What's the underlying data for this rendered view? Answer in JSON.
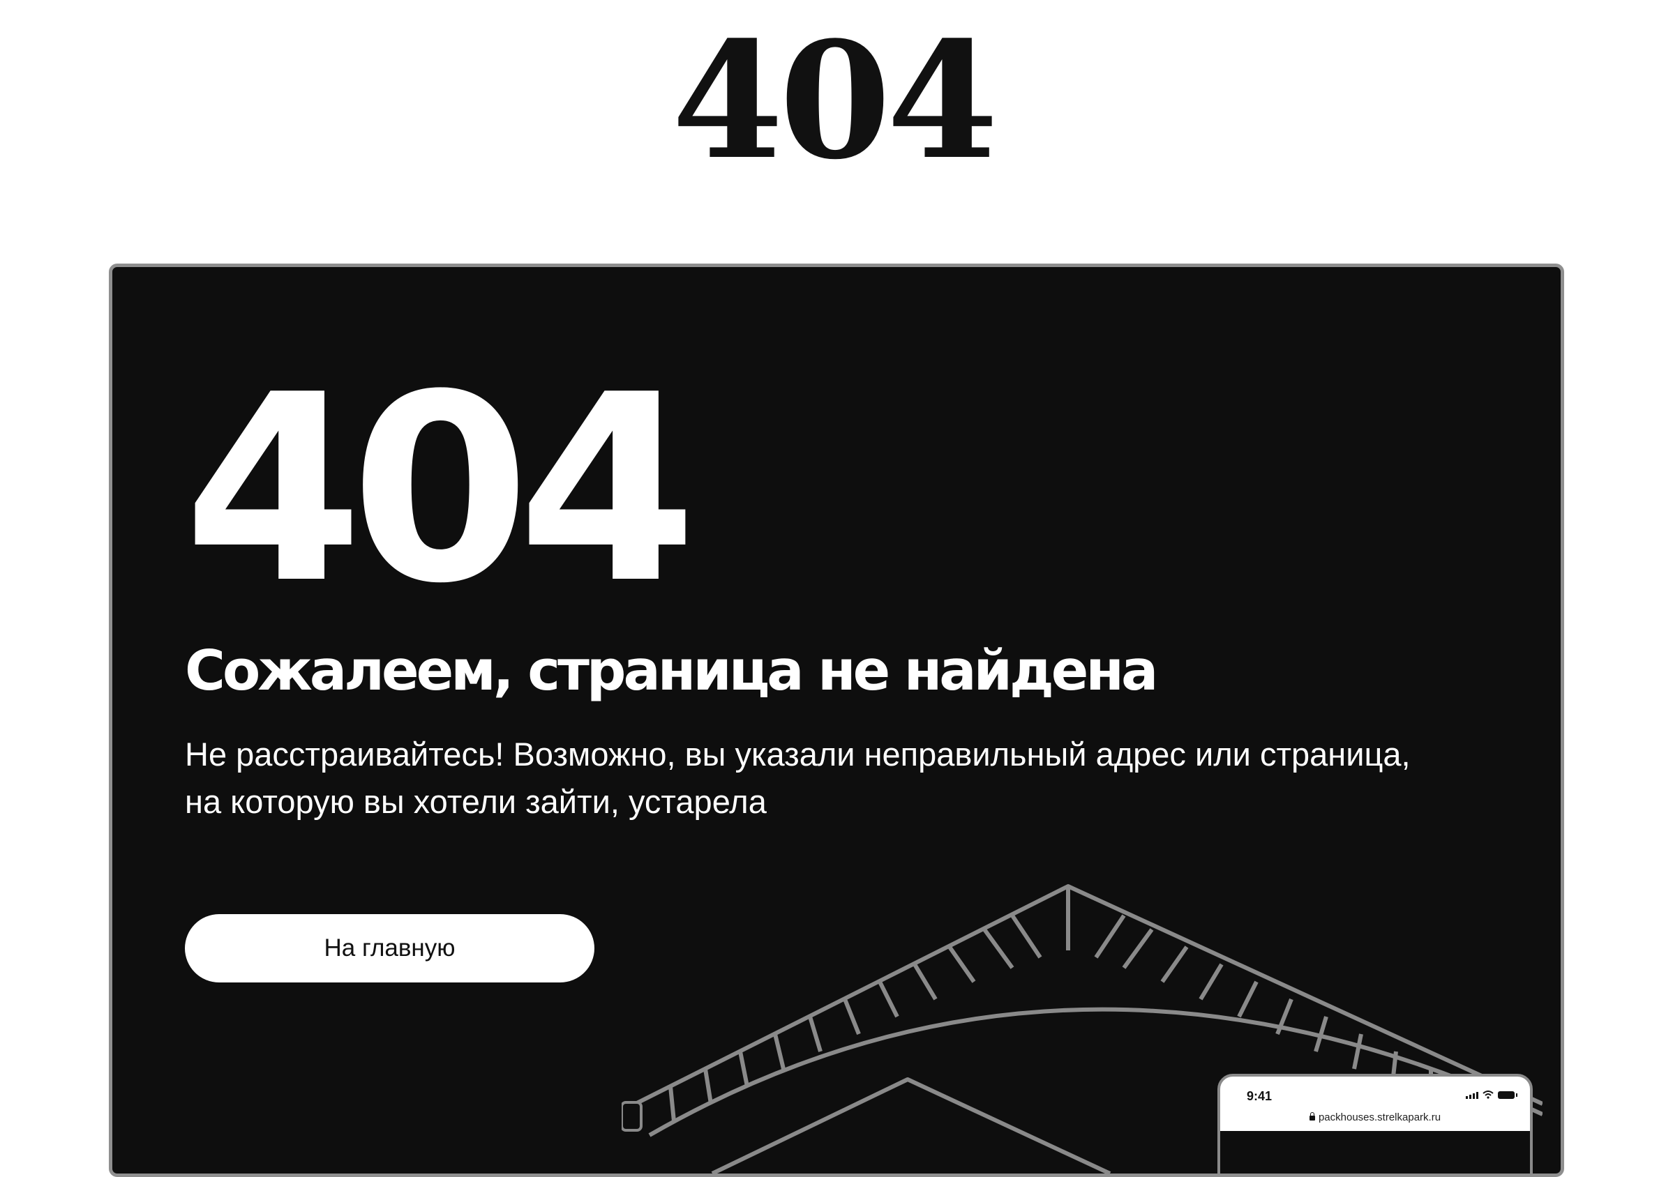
{
  "page": {
    "title": "404"
  },
  "card": {
    "code": "404",
    "heading": "Сожалеем, страница не найдена",
    "description": "Не расстраивайтесь! Возможно, вы указали неправильный адрес или страница, на которую вы хотели зайти, устарела",
    "home_button_label": "На главную"
  },
  "phone": {
    "time": "9:41",
    "url": "packhouses.strelkapark.ru",
    "status_icons": [
      "signal-icon",
      "wifi-icon",
      "battery-icon"
    ]
  },
  "colors": {
    "page_background": "#ffffff",
    "card_background": "#0e0e0e",
    "card_border": "#8f8f8f",
    "text_on_dark": "#ffffff",
    "button_background": "#ffffff",
    "button_text": "#111111",
    "structure_stroke": "#8a8a8a"
  }
}
